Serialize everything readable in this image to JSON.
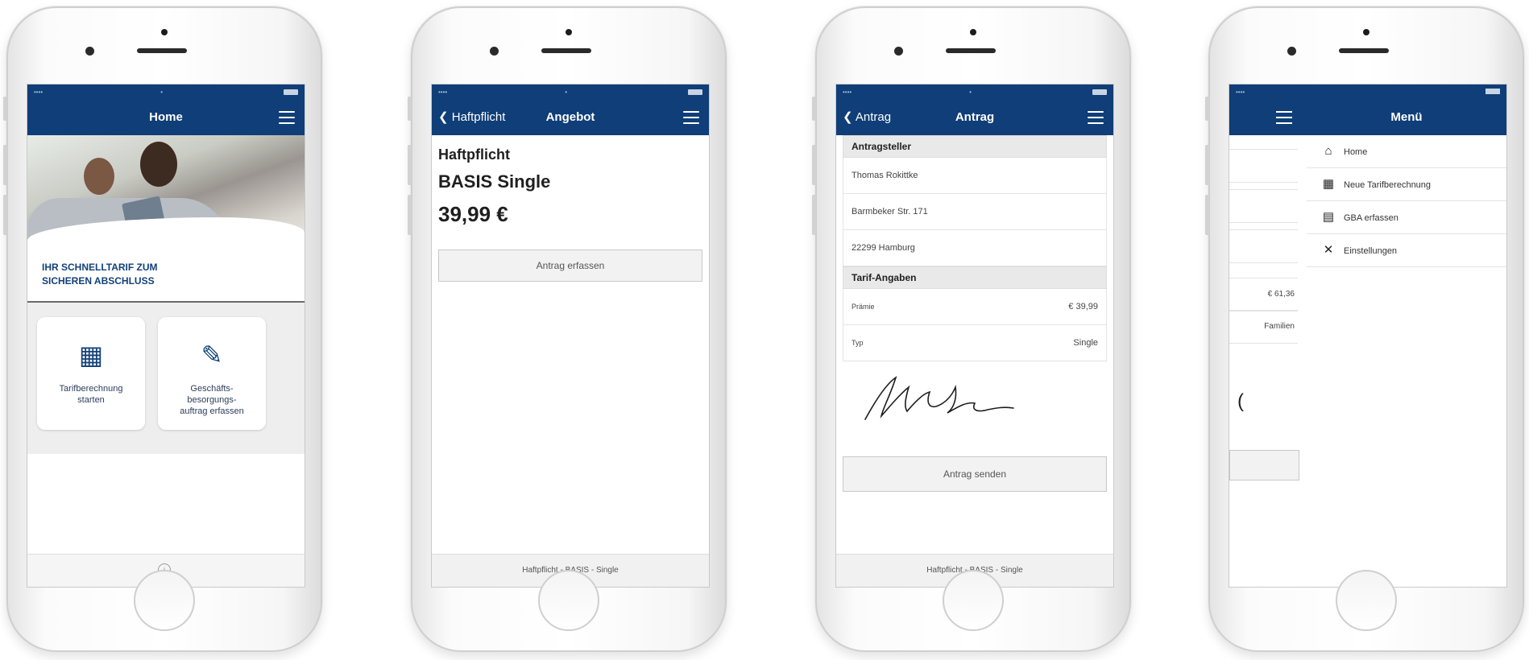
{
  "colors": {
    "navbar": "#0f3e78",
    "accent_text": "#12407a"
  },
  "phone1": {
    "nav_title": "Home",
    "tagline_line1": "IHR SCHNELLTARIF ZUM",
    "tagline_line2": "SICHEREN ABSCHLUSS",
    "tiles": [
      {
        "icon": "calculator-icon",
        "label_line1": "Tarifberechnung",
        "label_line2": "starten"
      },
      {
        "icon": "edit-icon",
        "label_line1": "Geschäfts-",
        "label_line2": "besorgungs-",
        "label_line3": "auftrag erfassen"
      }
    ]
  },
  "phone2": {
    "back_label": "Haftpflicht",
    "nav_title": "Angebot",
    "product": "Haftpflicht",
    "tariff": "BASIS Single",
    "price": "39,99 €",
    "button": "Antrag erfassen",
    "footer": "Haftpflicht - BASIS - Single"
  },
  "phone3": {
    "back_label": "Antrag",
    "nav_title": "Antrag",
    "section1": "Antragsteller",
    "name": "Thomas Rokittke",
    "street": "Barmbeker Str. 171",
    "city": "22299 Hamburg",
    "section2": "Tarif-Angaben",
    "premium_label": "Prämie",
    "premium_value": "€ 39,99",
    "type_label": "Typ",
    "type_value": "Single",
    "button": "Antrag senden",
    "footer": "Haftpflicht - BASIS - Single"
  },
  "phone4": {
    "menu_title": "Menü",
    "behind_value1": "€ 61,36",
    "behind_value2": "Familien",
    "items": [
      {
        "icon": "home-icon",
        "label": "Home"
      },
      {
        "icon": "calculator-icon",
        "label": "Neue Tarifberechnung"
      },
      {
        "icon": "document-icon",
        "label": "GBA erfassen"
      },
      {
        "icon": "tools-icon",
        "label": "Einstellungen"
      }
    ]
  }
}
